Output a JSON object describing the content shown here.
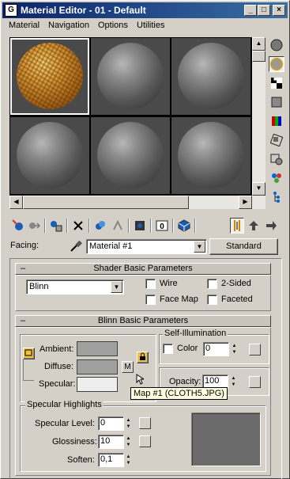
{
  "window": {
    "title": "Material Editor - 01 - Default",
    "icon_label": "G",
    "min_glyph": "_",
    "max_glyph": "□",
    "close_glyph": "×"
  },
  "menu": [
    "Material",
    "Navigation",
    "Options",
    "Utilities"
  ],
  "sample_slots": {
    "selected_index": 0,
    "count": 6
  },
  "side_tools": [
    "sample-type-icon",
    "backlight-icon",
    "background-checker-icon",
    "uv-tiling-icon",
    "video-color-check-icon",
    "make-preview-icon",
    "options-icon",
    "select-by-material-icon",
    "material-map-navigator-icon"
  ],
  "toolbar_tools": [
    "get-material-icon",
    "put-to-scene-icon",
    "assign-to-selection-icon",
    "reset-map-icon",
    "make-copy-icon",
    "make-unique-icon",
    "put-to-library-icon",
    "material-effects-channel-icon",
    "show-map-in-viewport-icon",
    "show-end-result-icon",
    "go-to-parent-icon",
    "go-forward-to-sibling-icon"
  ],
  "facing": {
    "label": "Facing:",
    "material_name": "Material #1",
    "type_button": "Standard"
  },
  "shader_rollout": {
    "title": "Shader Basic Parameters",
    "collapse_glyph": "–",
    "shader": "Blinn",
    "wire": "Wire",
    "two_sided": "2-Sided",
    "face_map": "Face Map",
    "faceted": "Faceted"
  },
  "blinn_rollout": {
    "title": "Blinn Basic Parameters",
    "collapse_glyph": "–",
    "ambient_label": "Ambient:",
    "diffuse_label": "Diffuse:",
    "specular_label": "Specular:",
    "ambient_color": "#a0a0a0",
    "diffuse_color": "#a0a0a0",
    "specular_color": "#eeeeee",
    "diffuse_map_button": "M",
    "self_illum_title": "Self-Illumination",
    "color_label": "Color",
    "self_illum_value": "0",
    "opacity_label": "Opacity:",
    "opacity_value": "100",
    "tooltip": "Map #1 (CLOTH5.JPG)"
  },
  "specular_highlights": {
    "title": "Specular Highlights",
    "level_label": "Specular Level:",
    "level_value": "0",
    "gloss_label": "Glossiness:",
    "gloss_value": "10",
    "soften_label": "Soften:",
    "soften_value": "0,1"
  }
}
